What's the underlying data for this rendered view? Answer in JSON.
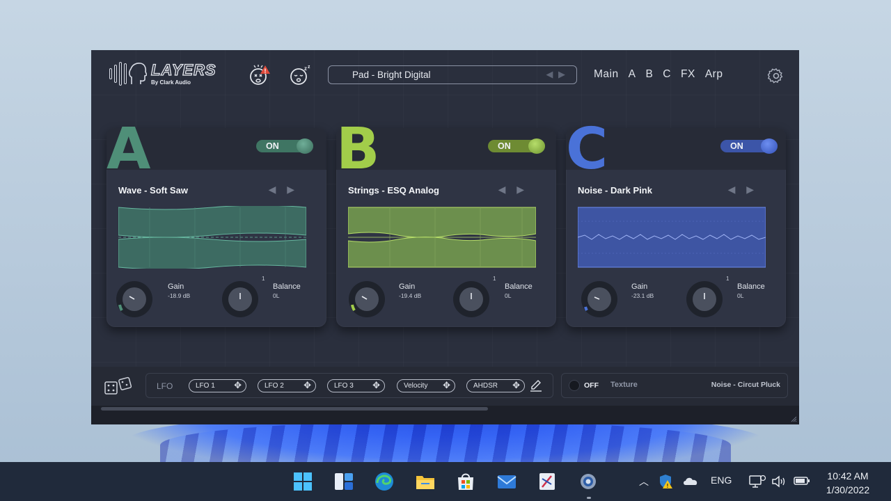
{
  "plugin": {
    "logo": {
      "title": "LAYERS",
      "subtitle": "By Clark Audio"
    },
    "preset": {
      "name": "Pad - Bright Digital",
      "arrows": "◀ ▶"
    },
    "nav": [
      "Main",
      "A",
      "B",
      "C",
      "FX",
      "Arp"
    ],
    "icons": [
      "panic-face-icon",
      "sleep-face-icon",
      "gear-icon"
    ]
  },
  "layers": [
    {
      "letter": "A",
      "color": "#4f8f78",
      "toggle": "ON",
      "sound": "Wave - Soft Saw",
      "arrows": "◀ ▶",
      "gain_label": "Gain",
      "gain_value": "-18.9 dB",
      "balance_label": "Balance",
      "balance_value": "0L",
      "balance_top": "1"
    },
    {
      "letter": "B",
      "color": "#a2cd4a",
      "toggle": "ON",
      "sound": "Strings - ESQ Analog",
      "arrows": "◀ ▶",
      "gain_label": "Gain",
      "gain_value": "-19.4 dB",
      "balance_label": "Balance",
      "balance_value": "0L",
      "balance_top": "1"
    },
    {
      "letter": "C",
      "color": "#4a72d8",
      "toggle": "ON",
      "sound": "Noise - Dark Pink",
      "arrows": "◀ ▶",
      "gain_label": "Gain",
      "gain_value": "-23.1 dB",
      "balance_label": "Balance",
      "balance_value": "0L",
      "balance_top": "1"
    }
  ],
  "bottom": {
    "lfo_label": "LFO",
    "modulators": [
      "LFO 1",
      "LFO 2",
      "LFO 3",
      "Velocity",
      "AHDSR"
    ],
    "texture_toggle": "OFF",
    "texture_label": "Texture",
    "texture_name": "Noise - Circut Pluck"
  },
  "taskbar": {
    "apps": [
      "windows-start-icon",
      "widgets-icon",
      "edge-icon",
      "file-explorer-icon",
      "store-icon",
      "mail-icon",
      "snipping-icon",
      "settings-icon"
    ],
    "tray": {
      "lang": "ENG",
      "time": "10:42 AM",
      "date": "1/30/2022"
    }
  }
}
